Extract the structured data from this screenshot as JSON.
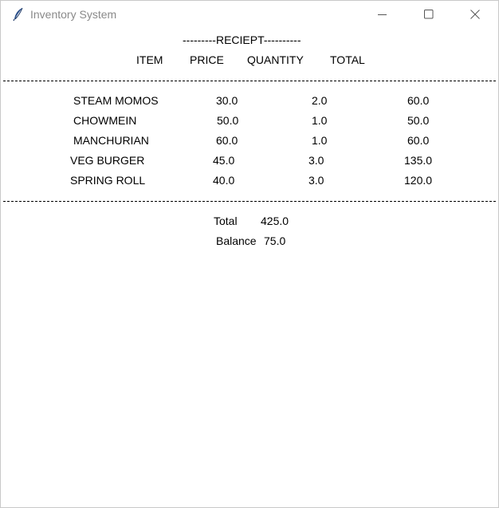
{
  "window": {
    "title": "Inventory System",
    "app_icon": "feather-icon",
    "controls": [
      "minimize-icon",
      "maximize-icon",
      "close-icon"
    ]
  },
  "receipt": {
    "heading": "---------RECIEPT----------",
    "headers": {
      "item": "ITEM",
      "price": "PRICE",
      "quantity": "QUANTITY",
      "total": "TOTAL"
    },
    "rows": [
      {
        "item": "STEAM MOMOS",
        "price": "30.0",
        "quantity": "2.0",
        "total": "60.0"
      },
      {
        "item": "CHOWMEIN",
        "price": "50.0",
        "quantity": "1.0",
        "total": "50.0"
      },
      {
        "item": "MANCHURIAN",
        "price": "60.0",
        "quantity": "1.0",
        "total": "60.0"
      },
      {
        "item": "VEG BURGER",
        "price": "45.0",
        "quantity": "3.0",
        "total": "135.0"
      },
      {
        "item": "SPRING ROLL",
        "price": "40.0",
        "quantity": "3.0",
        "total": "120.0"
      }
    ],
    "summary": {
      "total_label": "Total",
      "total_value": "425.0",
      "balance_label": "Balance",
      "balance_value": "75.0"
    }
  }
}
